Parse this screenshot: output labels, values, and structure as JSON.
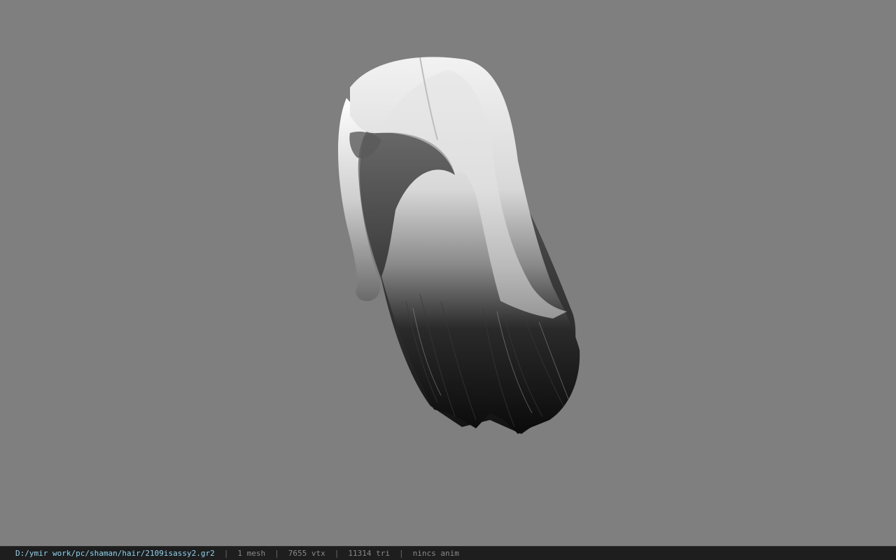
{
  "status_bar": {
    "file_path": "D:/ymir work/pc/shaman/hair/2109isassy2.gr2",
    "separator": "|",
    "mesh_count": "1 mesh",
    "vertex_count": "7655 vtx",
    "triangle_count": "11314 tri",
    "animation": "nincs anim"
  },
  "viewport": {
    "background_color": "#7f7f7f",
    "model": "hair-mesh"
  },
  "colors": {
    "path_text": "#8fd3f0",
    "status_text": "#8a8a8a",
    "status_bg": "#1e1e1e"
  }
}
